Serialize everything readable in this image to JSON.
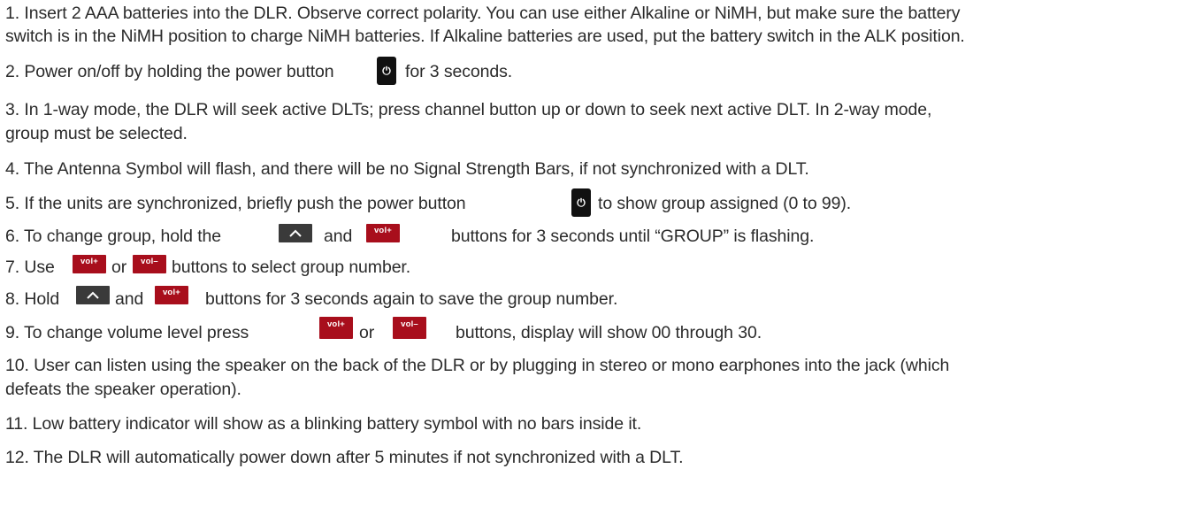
{
  "icons": {
    "power": "power-icon",
    "up": "chevron-up-icon"
  },
  "colors": {
    "text": "#2b2b2b",
    "power_key": "#111111",
    "arrow_key": "#3a3a3a",
    "vol_key": "#a80e1c"
  },
  "keys": {
    "power_glyph": "⏻",
    "vol_plus": "vol+",
    "vol_minus": "vol–"
  },
  "steps": {
    "s1_line1": "1. Insert 2 AAA batteries into the DLR. Observe correct polarity.  You can use either Alkaline or NiMH, but make sure the battery",
    "s1_line2": "switch is in the NiMH position to charge NiMH batteries.  If Alkaline batteries are used, put the battery switch in the ALK position.",
    "s2_a": "2. Power on/off by holding the power button",
    "s2_b": "for 3 seconds.",
    "s3_line1": "3. In 1-way mode, the DLR will seek active DLTs; press channel button up or down to seek next active DLT.  In 2-way mode,",
    "s3_line2": "group must be selected.",
    "s4": "4. The Antenna Symbol will flash, and there will be no Signal Strength Bars, if not synchronized with a DLT.",
    "s5_a": "5. If the units are synchronized, briefly push the power button",
    "s5_b": "to show group assigned (0 to 99).",
    "s6_a": "6. To change group, hold the",
    "s6_b": "and",
    "s6_c": "buttons for 3 seconds until “GROUP” is flashing.",
    "s7_a": "7. Use",
    "s7_b": "or",
    "s7_c": "buttons to select group number.",
    "s8_a": "8. Hold",
    "s8_b": "and",
    "s8_c": "buttons for 3 seconds again to save the group number.",
    "s9_a": "9. To change volume level press",
    "s9_b": "or",
    "s9_c": "buttons, display will show 00 through 30.",
    "s10_line1": "10. User can listen using the speaker on the back of the DLR or by plugging in stereo or mono earphones into the jack (which",
    "s10_line2": "defeats the speaker operation).",
    "s11": "11. Low battery indicator will show as a blinking battery symbol with no bars inside it.",
    "s12": "12. The DLR will automatically power down after 5 minutes if not synchronized with a DLT."
  }
}
